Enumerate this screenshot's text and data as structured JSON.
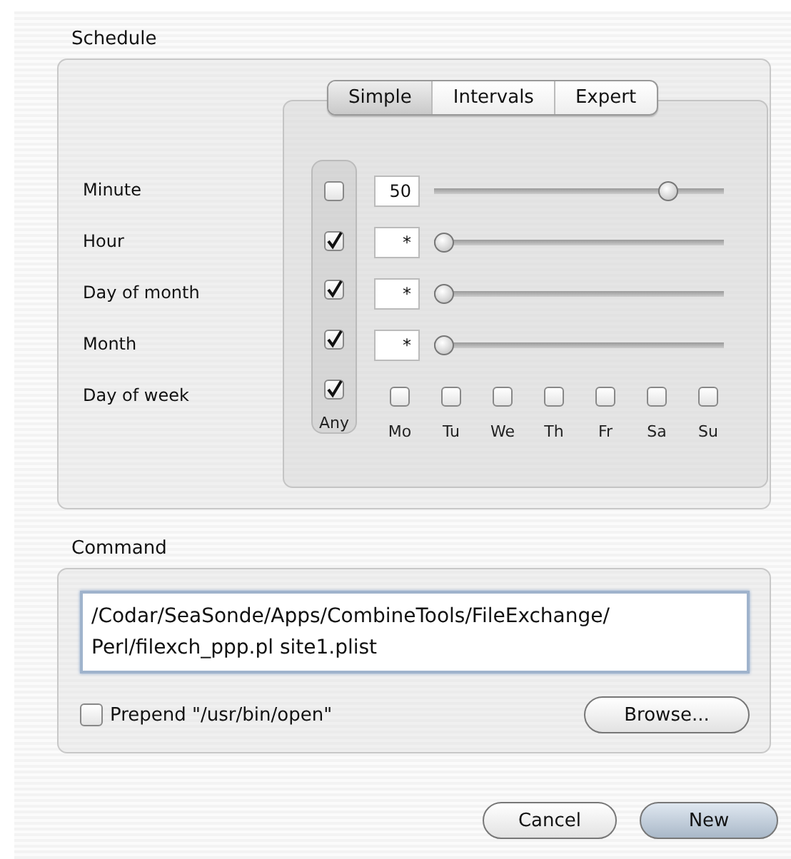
{
  "schedule": {
    "title": "Schedule",
    "tabs": [
      {
        "label": "Simple",
        "selected": true
      },
      {
        "label": "Intervals",
        "selected": false
      },
      {
        "label": "Expert",
        "selected": false
      }
    ],
    "rows": [
      {
        "label": "Minute",
        "kind": "slider",
        "any_checked": false,
        "value": "50",
        "level": 0.83
      },
      {
        "label": "Hour",
        "kind": "slider",
        "any_checked": true,
        "value": "*",
        "level": 0
      },
      {
        "label": "Day of month",
        "kind": "slider",
        "any_checked": true,
        "value": "*",
        "level": 0
      },
      {
        "label": "Month",
        "kind": "slider",
        "any_checked": true,
        "value": "*",
        "level": 0
      },
      {
        "label": "Day of week",
        "kind": "days",
        "any_checked": true,
        "days": [
          {
            "label": "Mo",
            "checked": false
          },
          {
            "label": "Tu",
            "checked": false
          },
          {
            "label": "We",
            "checked": false
          },
          {
            "label": "Th",
            "checked": false
          },
          {
            "label": "Fr",
            "checked": false
          },
          {
            "label": "Sa",
            "checked": false
          },
          {
            "label": "Su",
            "checked": false
          }
        ]
      }
    ],
    "any_label": "Any"
  },
  "command": {
    "title": "Command",
    "value_lines": [
      "/Codar/SeaSonde/Apps/CombineTools/FileExchange/",
      "Perl/filexch_ppp.pl site1.plist"
    ],
    "prepend": {
      "label": "Prepend \"/usr/bin/open\"",
      "checked": false
    },
    "browse": "Browse..."
  },
  "buttons": [
    {
      "label": "Cancel",
      "default": false
    },
    {
      "label": "New",
      "default": true
    }
  ]
}
